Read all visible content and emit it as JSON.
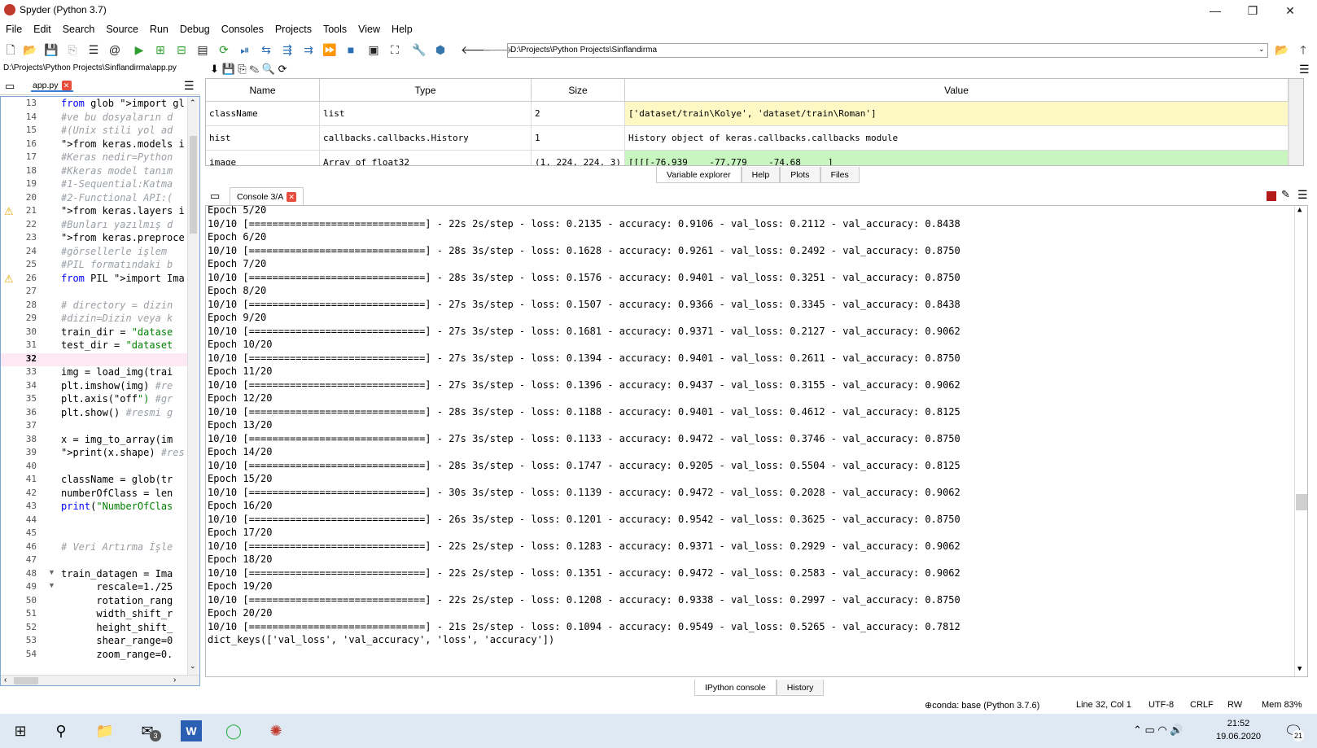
{
  "window": {
    "title": "Spyder (Python 3.7)",
    "minimize": "—",
    "maximize": "❐",
    "close": "✕"
  },
  "menu": [
    "File",
    "Edit",
    "Search",
    "Source",
    "Run",
    "Debug",
    "Consoles",
    "Projects",
    "Tools",
    "View",
    "Help"
  ],
  "toolbar": {
    "path": "D:\\Projects\\Python Projects\\Sinflandirma"
  },
  "editor": {
    "file_path": "D:\\Projects\\Python Projects\\Sinflandirma\\app.py",
    "tab_label": "app.py",
    "lines": [
      {
        "n": "13",
        "t": "from glob import gl",
        "k": "code"
      },
      {
        "n": "14",
        "t": "#ve bu dosyaların d",
        "k": "comment"
      },
      {
        "n": "15",
        "t": "#(Unix stili yol ad",
        "k": "comment"
      },
      {
        "n": "16",
        "t": "from keras.models i",
        "k": "code"
      },
      {
        "n": "17",
        "t": "#Keras nedir=Python",
        "k": "comment"
      },
      {
        "n": "18",
        "t": "#Kkeras model tanım",
        "k": "comment"
      },
      {
        "n": "19",
        "t": "#1-Sequential:Katma",
        "k": "comment"
      },
      {
        "n": "20",
        "t": "#2-Functional API:(",
        "k": "comment"
      },
      {
        "n": "21",
        "t": "from keras.layers i",
        "k": "code",
        "warn": true
      },
      {
        "n": "22",
        "t": "#Bunları yazılmış d",
        "k": "comment"
      },
      {
        "n": "23",
        "t": "from keras.preproce",
        "k": "code"
      },
      {
        "n": "24",
        "t": "#görsellerle işlem",
        "k": "comment"
      },
      {
        "n": "25",
        "t": "#PIL formatındaki b",
        "k": "comment"
      },
      {
        "n": "26",
        "t": "from PIL import Ima",
        "k": "code",
        "warn": true
      },
      {
        "n": "27",
        "t": "",
        "k": "code"
      },
      {
        "n": "28",
        "t": "# directory = dizin",
        "k": "comment"
      },
      {
        "n": "29",
        "t": "#dizin=Dizin veya k",
        "k": "comment"
      },
      {
        "n": "30",
        "t": "train_dir = \"datase",
        "k": "code"
      },
      {
        "n": "31",
        "t": "test_dir = \"dataset",
        "k": "code"
      },
      {
        "n": "32",
        "t": "",
        "k": "code",
        "current": true
      },
      {
        "n": "33",
        "t": "img = load_img(trai",
        "k": "code"
      },
      {
        "n": "34",
        "t": "plt.imshow(img) #re",
        "k": "code"
      },
      {
        "n": "35",
        "t": "plt.axis(\"off\") #gr",
        "k": "code"
      },
      {
        "n": "36",
        "t": "plt.show() #resmi g",
        "k": "code"
      },
      {
        "n": "37",
        "t": "",
        "k": "code"
      },
      {
        "n": "38",
        "t": "x = img_to_array(im",
        "k": "code"
      },
      {
        "n": "39",
        "t": "print(x.shape) #res",
        "k": "code"
      },
      {
        "n": "40",
        "t": "",
        "k": "code"
      },
      {
        "n": "41",
        "t": "className = glob(tr",
        "k": "code"
      },
      {
        "n": "42",
        "t": "numberOfClass = len",
        "k": "code"
      },
      {
        "n": "43",
        "t": "print(\"NumberOfClas",
        "k": "code"
      },
      {
        "n": "44",
        "t": "",
        "k": "code"
      },
      {
        "n": "45",
        "t": "",
        "k": "code"
      },
      {
        "n": "46",
        "t": "# Veri Artırma İşle",
        "k": "comment"
      },
      {
        "n": "47",
        "t": "",
        "k": "code"
      },
      {
        "n": "48",
        "t": "train_datagen = Ima",
        "k": "code",
        "fold": true
      },
      {
        "n": "49",
        "t": "      rescale=1./25",
        "k": "code",
        "fold": true
      },
      {
        "n": "50",
        "t": "      rotation_rang",
        "k": "code"
      },
      {
        "n": "51",
        "t": "      width_shift_r",
        "k": "code"
      },
      {
        "n": "52",
        "t": "      height_shift_",
        "k": "code"
      },
      {
        "n": "53",
        "t": "      shear_range=0",
        "k": "code"
      },
      {
        "n": "54",
        "t": "      zoom_range=0.",
        "k": "code"
      }
    ]
  },
  "varexp": {
    "headers": [
      "Name",
      "Type",
      "Size",
      "Value"
    ],
    "rows": [
      {
        "name": "className",
        "type": "list",
        "size": "2",
        "value": "['dataset/train\\Kolye', 'dataset/train\\Roman']",
        "color": "#fdf8c4"
      },
      {
        "name": "hist",
        "type": "callbacks.callbacks.History",
        "size": "1",
        "value": "History object of keras.callbacks.callbacks module",
        "color": "#ffffff"
      },
      {
        "name": "image",
        "type": "Array of float32",
        "size": "(1, 224, 224, 3)",
        "value": "[[[[-76.939    -77.779    -74.68     ]",
        "color": "#c8f5c0"
      }
    ],
    "tabs": [
      "Variable explorer",
      "Help",
      "Plots",
      "Files"
    ]
  },
  "console": {
    "tab_label": "Console 3/A",
    "lines": [
      "Epoch 5/20",
      "10/10 [==============================] - 22s 2s/step - loss: 0.2135 - accuracy: 0.9106 - val_loss: 0.2112 - val_accuracy: 0.8438",
      "Epoch 6/20",
      "10/10 [==============================] - 28s 3s/step - loss: 0.1628 - accuracy: 0.9261 - val_loss: 0.2492 - val_accuracy: 0.8750",
      "Epoch 7/20",
      "10/10 [==============================] - 28s 3s/step - loss: 0.1576 - accuracy: 0.9401 - val_loss: 0.3251 - val_accuracy: 0.8750",
      "Epoch 8/20",
      "10/10 [==============================] - 27s 3s/step - loss: 0.1507 - accuracy: 0.9366 - val_loss: 0.3345 - val_accuracy: 0.8438",
      "Epoch 9/20",
      "10/10 [==============================] - 27s 3s/step - loss: 0.1681 - accuracy: 0.9371 - val_loss: 0.2127 - val_accuracy: 0.9062",
      "Epoch 10/20",
      "10/10 [==============================] - 27s 3s/step - loss: 0.1394 - accuracy: 0.9401 - val_loss: 0.2611 - val_accuracy: 0.8750",
      "Epoch 11/20",
      "10/10 [==============================] - 27s 3s/step - loss: 0.1396 - accuracy: 0.9437 - val_loss: 0.3155 - val_accuracy: 0.9062",
      "Epoch 12/20",
      "10/10 [==============================] - 28s 3s/step - loss: 0.1188 - accuracy: 0.9401 - val_loss: 0.4612 - val_accuracy: 0.8125",
      "Epoch 13/20",
      "10/10 [==============================] - 27s 3s/step - loss: 0.1133 - accuracy: 0.9472 - val_loss: 0.3746 - val_accuracy: 0.8750",
      "Epoch 14/20",
      "10/10 [==============================] - 28s 3s/step - loss: 0.1747 - accuracy: 0.9205 - val_loss: 0.5504 - val_accuracy: 0.8125",
      "Epoch 15/20",
      "10/10 [==============================] - 30s 3s/step - loss: 0.1139 - accuracy: 0.9472 - val_loss: 0.2028 - val_accuracy: 0.9062",
      "Epoch 16/20",
      "10/10 [==============================] - 26s 3s/step - loss: 0.1201 - accuracy: 0.9542 - val_loss: 0.3625 - val_accuracy: 0.8750",
      "Epoch 17/20",
      "10/10 [==============================] - 22s 2s/step - loss: 0.1283 - accuracy: 0.9371 - val_loss: 0.2929 - val_accuracy: 0.9062",
      "Epoch 18/20",
      "10/10 [==============================] - 22s 2s/step - loss: 0.1351 - accuracy: 0.9472 - val_loss: 0.2583 - val_accuracy: 0.9062",
      "Epoch 19/20",
      "10/10 [==============================] - 22s 2s/step - loss: 0.1208 - accuracy: 0.9338 - val_loss: 0.2997 - val_accuracy: 0.8750",
      "Epoch 20/20",
      "10/10 [==============================] - 21s 2s/step - loss: 0.1094 - accuracy: 0.9549 - val_loss: 0.5265 - val_accuracy: 0.7812",
      "dict_keys(['val_loss', 'val_accuracy', 'loss', 'accuracy'])"
    ],
    "tabs": [
      "IPython console",
      "History"
    ]
  },
  "status": {
    "conda": "conda: base (Python 3.7.6)",
    "position": "Line 32, Col 1",
    "encoding": "UTF-8",
    "eol": "CRLF",
    "rw": "RW",
    "mem": "Mem 83%"
  },
  "taskbar": {
    "time": "21:52",
    "date": "19.06.2020",
    "mail_badge": "3",
    "notif_badge": "21"
  }
}
